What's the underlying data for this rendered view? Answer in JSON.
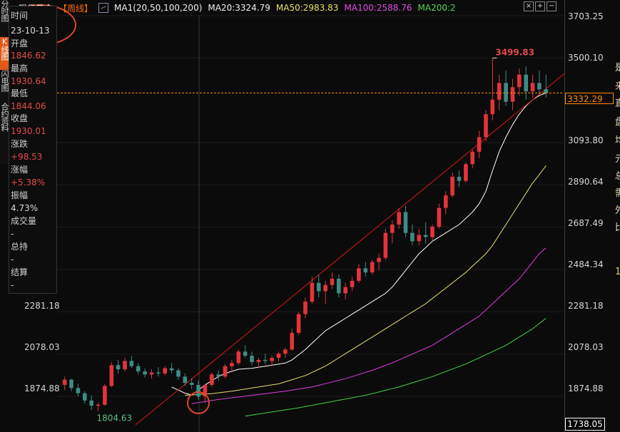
{
  "header": {
    "title": "现货黄金",
    "period": "【周线】",
    "ma1": "MA1(20,50,100,200)",
    "ma20": "MA20:3324.79",
    "ma50": "MA50:2983.83",
    "ma100": "MA100:2588.76",
    "ma200": "MA200:2"
  },
  "colors": {
    "up": "#e3343a",
    "down": "#3d8c86",
    "ma20": "#ffffff",
    "ma50": "#e6e06b",
    "ma100": "#d93ee0",
    "ma200": "#45d143",
    "trendline": "#d81616",
    "price_line": "#ff8a00"
  },
  "sidebar_tabs": [
    {
      "label": "分时图",
      "active": false
    },
    {
      "label": "K线图",
      "active": true
    },
    {
      "label": "闪电图",
      "active": false
    },
    {
      "label": "合约资料",
      "active": false
    }
  ],
  "info_panel": {
    "time_label": "时间",
    "time_value": "23-10-13",
    "open_label": "开盘",
    "open_value": "1846.62",
    "high_label": "最高",
    "high_value": "1930.64",
    "low_label": "最低",
    "low_value": "1844.06",
    "close_label": "收盘",
    "close_value": "1930.01",
    "change_label": "涨跌",
    "change_value": "+98.53",
    "pct_label": "涨幅",
    "pct_value": "+5.38%",
    "amp_label": "振幅",
    "amp_value": "4.73%",
    "volume_label": "成交量",
    "volume_value": "-",
    "oi_label": "总持",
    "oi_value": "-",
    "settle_label": "结算",
    "settle_value": "-"
  },
  "right_axis_ticks": [
    "3703.25",
    "3500.10",
    "3093.80",
    "2890.64",
    "2687.49",
    "2484.34",
    "2281.18",
    "2078.03",
    "1874.88"
  ],
  "left_axis_ticks": [
    "2281.18",
    "2078.03",
    "1874.88"
  ],
  "current_price": "3332.29",
  "bottom_price": "1738.05",
  "peak_label": "3499.83",
  "low_label": "1804.63",
  "side_chars": [
    "是",
    "来",
    "直",
    "盘",
    "均",
    "元",
    "总",
    "需",
    "外",
    "比",
    "1"
  ],
  "chart_data": {
    "type": "candlestick",
    "ylim": [
      1738.05,
      3703.25
    ],
    "series": [
      {
        "name": "MA20",
        "values": [
          1920,
          1905,
          1890,
          1882,
          1905,
          1930,
          1950,
          1970,
          1985,
          1995,
          2005,
          2008,
          2010,
          2015,
          2020,
          2025,
          2030,
          2035,
          2050,
          2075,
          2100,
          2130,
          2160,
          2190,
          2210,
          2230,
          2250,
          2270,
          2290,
          2310,
          2330,
          2350,
          2370,
          2400,
          2440,
          2480,
          2520,
          2560,
          2590,
          2620,
          2640,
          2660,
          2680,
          2700,
          2730,
          2760,
          2800,
          2860,
          2960,
          3050,
          3120,
          3180,
          3230,
          3270,
          3300,
          3320,
          3332
        ]
      },
      {
        "name": "MA50",
        "values": [
          1880,
          1882,
          1884,
          1886,
          1888,
          1892,
          1896,
          1900,
          1905,
          1910,
          1915,
          1920,
          1925,
          1930,
          1935,
          1945,
          1955,
          1965,
          1975,
          1990,
          2005,
          2020,
          2040,
          2060,
          2080,
          2100,
          2120,
          2140,
          2160,
          2180,
          2200,
          2220,
          2240,
          2260,
          2280,
          2300,
          2320,
          2345,
          2370,
          2395,
          2420,
          2445,
          2470,
          2500,
          2530,
          2560,
          2600,
          2650,
          2700,
          2750,
          2800,
          2850,
          2900,
          2940,
          2983
        ]
      },
      {
        "name": "MA100",
        "values": [
          1840,
          1845,
          1850,
          1855,
          1860,
          1864,
          1868,
          1872,
          1876,
          1880,
          1884,
          1888,
          1892,
          1896,
          1900,
          1905,
          1910,
          1915,
          1920,
          1928,
          1936,
          1944,
          1952,
          1960,
          1970,
          1980,
          1990,
          2000,
          2012,
          2024,
          2036,
          2050,
          2064,
          2078,
          2092,
          2106,
          2120,
          2140,
          2160,
          2180,
          2200,
          2220,
          2240,
          2260,
          2290,
          2320,
          2350,
          2380,
          2410,
          2440,
          2480,
          2520,
          2560,
          2588
        ]
      },
      {
        "name": "MA200",
        "values": [
          1780,
          1785,
          1790,
          1795,
          1800,
          1805,
          1810,
          1815,
          1820,
          1826,
          1832,
          1838,
          1844,
          1850,
          1856,
          1862,
          1868,
          1874,
          1880,
          1888,
          1896,
          1904,
          1912,
          1920,
          1930,
          1940,
          1950,
          1960,
          1970,
          1982,
          1994,
          2006,
          2018,
          2030,
          2045,
          2060,
          2075,
          2090,
          2105,
          2120,
          2140,
          2160,
          2180,
          2200,
          2225,
          2250
        ]
      }
    ],
    "candles": [
      [
        1930,
        1970,
        1905,
        1955
      ],
      [
        1955,
        1960,
        1900,
        1915
      ],
      [
        1915,
        1935,
        1875,
        1890
      ],
      [
        1890,
        1900,
        1840,
        1855
      ],
      [
        1855,
        1880,
        1810,
        1830
      ],
      [
        1830,
        1845,
        1804,
        1835
      ],
      [
        1835,
        1935,
        1830,
        1925
      ],
      [
        1925,
        2040,
        1920,
        2025
      ],
      [
        2025,
        2050,
        1985,
        2005
      ],
      [
        2005,
        2060,
        1995,
        2045
      ],
      [
        2045,
        2070,
        2010,
        2020
      ],
      [
        2020,
        2035,
        1980,
        1995
      ],
      [
        1995,
        2010,
        1965,
        1980
      ],
      [
        1980,
        2005,
        1960,
        1990
      ],
      [
        1990,
        2015,
        1970,
        1985
      ],
      [
        1985,
        2020,
        1975,
        2010
      ],
      [
        2010,
        2035,
        1985,
        2000
      ],
      [
        2000,
        2010,
        1955,
        1970
      ],
      [
        1970,
        1985,
        1925,
        1940
      ],
      [
        1940,
        1960,
        1910,
        1930
      ],
      [
        1930,
        1950,
        1860,
        1875
      ],
      [
        1875,
        1935,
        1844,
        1930
      ],
      [
        1930,
        1990,
        1920,
        1980
      ],
      [
        1980,
        2000,
        1950,
        1970
      ],
      [
        1970,
        2030,
        1960,
        2020
      ],
      [
        2020,
        2050,
        1995,
        2035
      ],
      [
        2035,
        2100,
        2025,
        2090
      ],
      [
        2090,
        2120,
        2060,
        2070
      ],
      [
        2070,
        2090,
        2025,
        2040
      ],
      [
        2040,
        2060,
        2010,
        2050
      ],
      [
        2050,
        2080,
        2030,
        2045
      ],
      [
        2045,
        2070,
        2020,
        2060
      ],
      [
        2060,
        2090,
        2040,
        2080
      ],
      [
        2080,
        2110,
        2060,
        2100
      ],
      [
        2100,
        2200,
        2095,
        2180
      ],
      [
        2180,
        2280,
        2170,
        2270
      ],
      [
        2270,
        2350,
        2250,
        2330
      ],
      [
        2330,
        2450,
        2320,
        2420
      ],
      [
        2420,
        2460,
        2350,
        2380
      ],
      [
        2380,
        2430,
        2320,
        2410
      ],
      [
        2410,
        2470,
        2390,
        2440
      ],
      [
        2440,
        2460,
        2350,
        2370
      ],
      [
        2370,
        2420,
        2340,
        2400
      ],
      [
        2400,
        2450,
        2380,
        2430
      ],
      [
        2430,
        2510,
        2420,
        2490
      ],
      [
        2490,
        2520,
        2450,
        2470
      ],
      [
        2470,
        2530,
        2460,
        2520
      ],
      [
        2520,
        2560,
        2480,
        2540
      ],
      [
        2540,
        2680,
        2530,
        2660
      ],
      [
        2660,
        2720,
        2610,
        2700
      ],
      [
        2700,
        2780,
        2680,
        2760
      ],
      [
        2760,
        2790,
        2640,
        2660
      ],
      [
        2660,
        2700,
        2600,
        2620
      ],
      [
        2620,
        2680,
        2600,
        2650
      ],
      [
        2650,
        2710,
        2610,
        2640
      ],
      [
        2640,
        2700,
        2620,
        2690
      ],
      [
        2690,
        2800,
        2680,
        2780
      ],
      [
        2780,
        2860,
        2750,
        2840
      ],
      [
        2840,
        2950,
        2830,
        2930
      ],
      [
        2930,
        2960,
        2880,
        2910
      ],
      [
        2910,
        3000,
        2900,
        2990
      ],
      [
        2990,
        3060,
        2970,
        3050
      ],
      [
        3050,
        3150,
        3020,
        3120
      ],
      [
        3120,
        3250,
        3100,
        3230
      ],
      [
        3230,
        3500,
        3200,
        3300
      ],
      [
        3300,
        3420,
        3250,
        3380
      ],
      [
        3380,
        3440,
        3270,
        3290
      ],
      [
        3290,
        3400,
        3250,
        3360
      ],
      [
        3360,
        3450,
        3320,
        3420
      ],
      [
        3420,
        3460,
        3300,
        3340
      ],
      [
        3340,
        3420,
        3310,
        3380
      ],
      [
        3380,
        3440,
        3320,
        3350
      ],
      [
        3350,
        3420,
        3310,
        3332
      ]
    ]
  }
}
